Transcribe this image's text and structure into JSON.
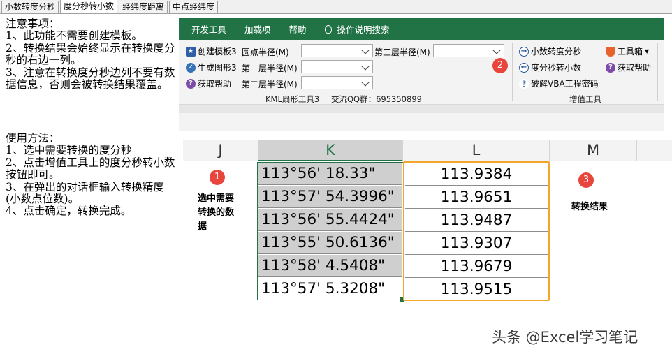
{
  "tabs": [
    "小数转度分秒",
    "度分秒转小数",
    "经纬度距离",
    "中点经纬度"
  ],
  "notes": {
    "title": "注意事项：",
    "lines": [
      "1、此功能不需要创建模板。",
      "2、转换结果会始终显示在转换度分秒的右边一列。",
      "3、注意在转换度分秒边列不要有数据信息，否则会被转换结果覆盖。"
    ]
  },
  "usage": {
    "title": "使用方法：",
    "lines": [
      "1、选中需要转换的度分秒",
      "2、点击增值工具上的度分秒转小数按钮即可。",
      "3、在弹出的对话框输入转换精度(小数点位数)。",
      "4、点击确定，转换完成。"
    ]
  },
  "ribbon": {
    "tabs": [
      "开发工具",
      "加载项",
      "帮助",
      "操作说明搜索"
    ],
    "buttons_left": [
      "创建模板3",
      "生成图形3",
      "获取帮助"
    ],
    "fields": {
      "circle_radius": "圆点半径(M)",
      "layer1": "第一层半径(M)",
      "layer2": "第二层半径(M)",
      "layer3": "第三层半径(M)"
    },
    "group_caption_left": "KML扇形工具3",
    "qq_group": "交流QQ群：695350899",
    "buttons_right": [
      "小数转度分秒",
      "度分秒转小数",
      "破解VBA工程密码"
    ],
    "toolbox": "工具箱",
    "help": "获取帮助",
    "group_caption_right": "增值工具",
    "colors": {
      "ribbon_green": "#217346",
      "badge_red": "#e8453c",
      "highlight_orange": "#f0a72a"
    }
  },
  "sheet": {
    "columns": [
      "J",
      "K",
      "L",
      "M"
    ],
    "k_values": [
      "113°56' 18.33\"",
      "113°57' 54.3996\"",
      "113°56' 55.4424\"",
      "113°55' 50.6136\"",
      "113°58' 4.5408\"",
      "113°57' 5.3208\""
    ],
    "l_values": [
      "113.9384",
      "113.9651",
      "113.9487",
      "113.9307",
      "113.9679",
      "113.9515"
    ]
  },
  "annotations": {
    "badge1": "1",
    "badge2": "2",
    "badge3": "3",
    "note1": "选中需要转换的数据",
    "note3": "转换结果"
  },
  "watermark": "头条 @Excel学习笔记"
}
